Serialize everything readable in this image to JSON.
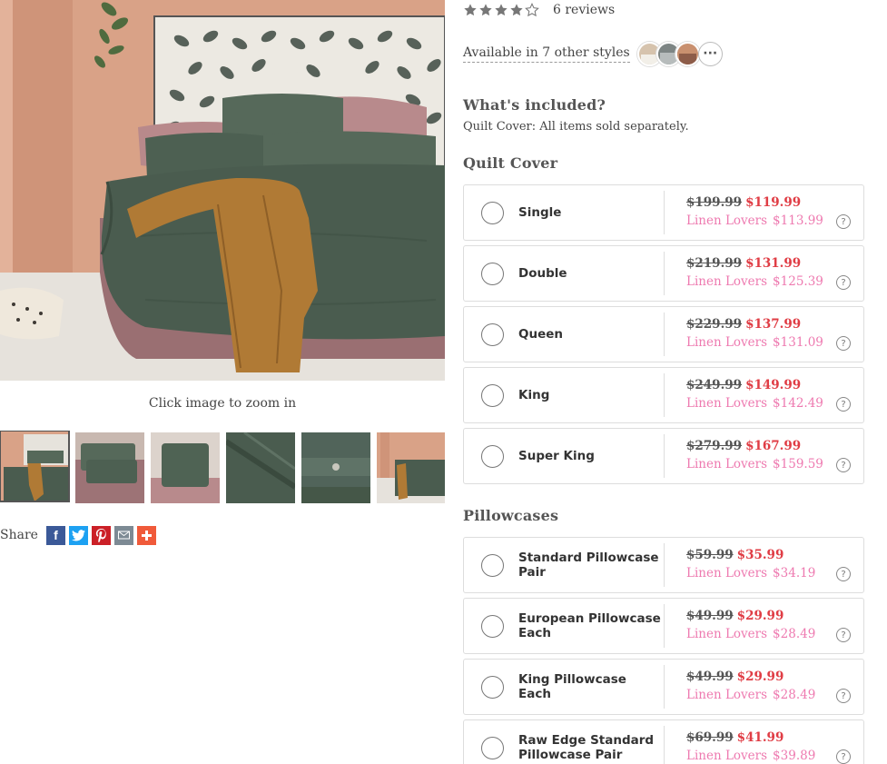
{
  "gallery": {
    "zoom_hint": "Click image to zoom in",
    "share_label": "Share",
    "social": [
      {
        "name": "facebook",
        "color": "#3b5998",
        "glyph": "f"
      },
      {
        "name": "twitter",
        "color": "#1da1f2",
        "glyph": "t"
      },
      {
        "name": "pinterest",
        "color": "#cb2027",
        "glyph": "p"
      },
      {
        "name": "email",
        "color": "#7d8a94",
        "glyph": "envelope"
      },
      {
        "name": "more",
        "color": "#f05a3a",
        "glyph": "+"
      }
    ]
  },
  "rating": {
    "stars": 4,
    "max": 5,
    "reviews_text": "6 reviews"
  },
  "styles": {
    "text": "Available in 7 other styles",
    "more_label": "···"
  },
  "included": {
    "title": "What's included?",
    "text": "Quilt Cover: All items sold separately."
  },
  "sections": {
    "quilt_cover": {
      "title": "Quilt Cover",
      "options": [
        {
          "name": "Single",
          "old_price": "$199.99",
          "new_price": "$119.99",
          "lovers_label": "Linen Lovers",
          "lovers_price": "$113.99"
        },
        {
          "name": "Double",
          "old_price": "$219.99",
          "new_price": "$131.99",
          "lovers_label": "Linen Lovers",
          "lovers_price": "$125.39"
        },
        {
          "name": "Queen",
          "old_price": "$229.99",
          "new_price": "$137.99",
          "lovers_label": "Linen Lovers",
          "lovers_price": "$131.09"
        },
        {
          "name": "King",
          "old_price": "$249.99",
          "new_price": "$149.99",
          "lovers_label": "Linen Lovers",
          "lovers_price": "$142.49"
        },
        {
          "name": "Super King",
          "old_price": "$279.99",
          "new_price": "$167.99",
          "lovers_label": "Linen Lovers",
          "lovers_price": "$159.59"
        }
      ]
    },
    "pillowcases": {
      "title": "Pillowcases",
      "options": [
        {
          "name": "Standard Pillowcase Pair",
          "old_price": "$59.99",
          "new_price": "$35.99",
          "lovers_label": "Linen Lovers",
          "lovers_price": "$34.19"
        },
        {
          "name": "European Pillowcase Each",
          "old_price": "$49.99",
          "new_price": "$29.99",
          "lovers_label": "Linen Lovers",
          "lovers_price": "$28.49"
        },
        {
          "name": "King Pillowcase Each",
          "old_price": "$49.99",
          "new_price": "$29.99",
          "lovers_label": "Linen Lovers",
          "lovers_price": "$28.49"
        },
        {
          "name": "Raw Edge Standard Pillowcase Pair",
          "old_price": "$69.99",
          "new_price": "$41.99",
          "lovers_label": "Linen Lovers",
          "lovers_price": "$39.89"
        }
      ]
    }
  },
  "colors": {
    "sale_red": "#e03d45",
    "member_pink": "#ee7ab0",
    "quilt_green": "#4a5c4f",
    "throw_mustard": "#b07a35",
    "wall_terracotta": "#d89e82"
  }
}
